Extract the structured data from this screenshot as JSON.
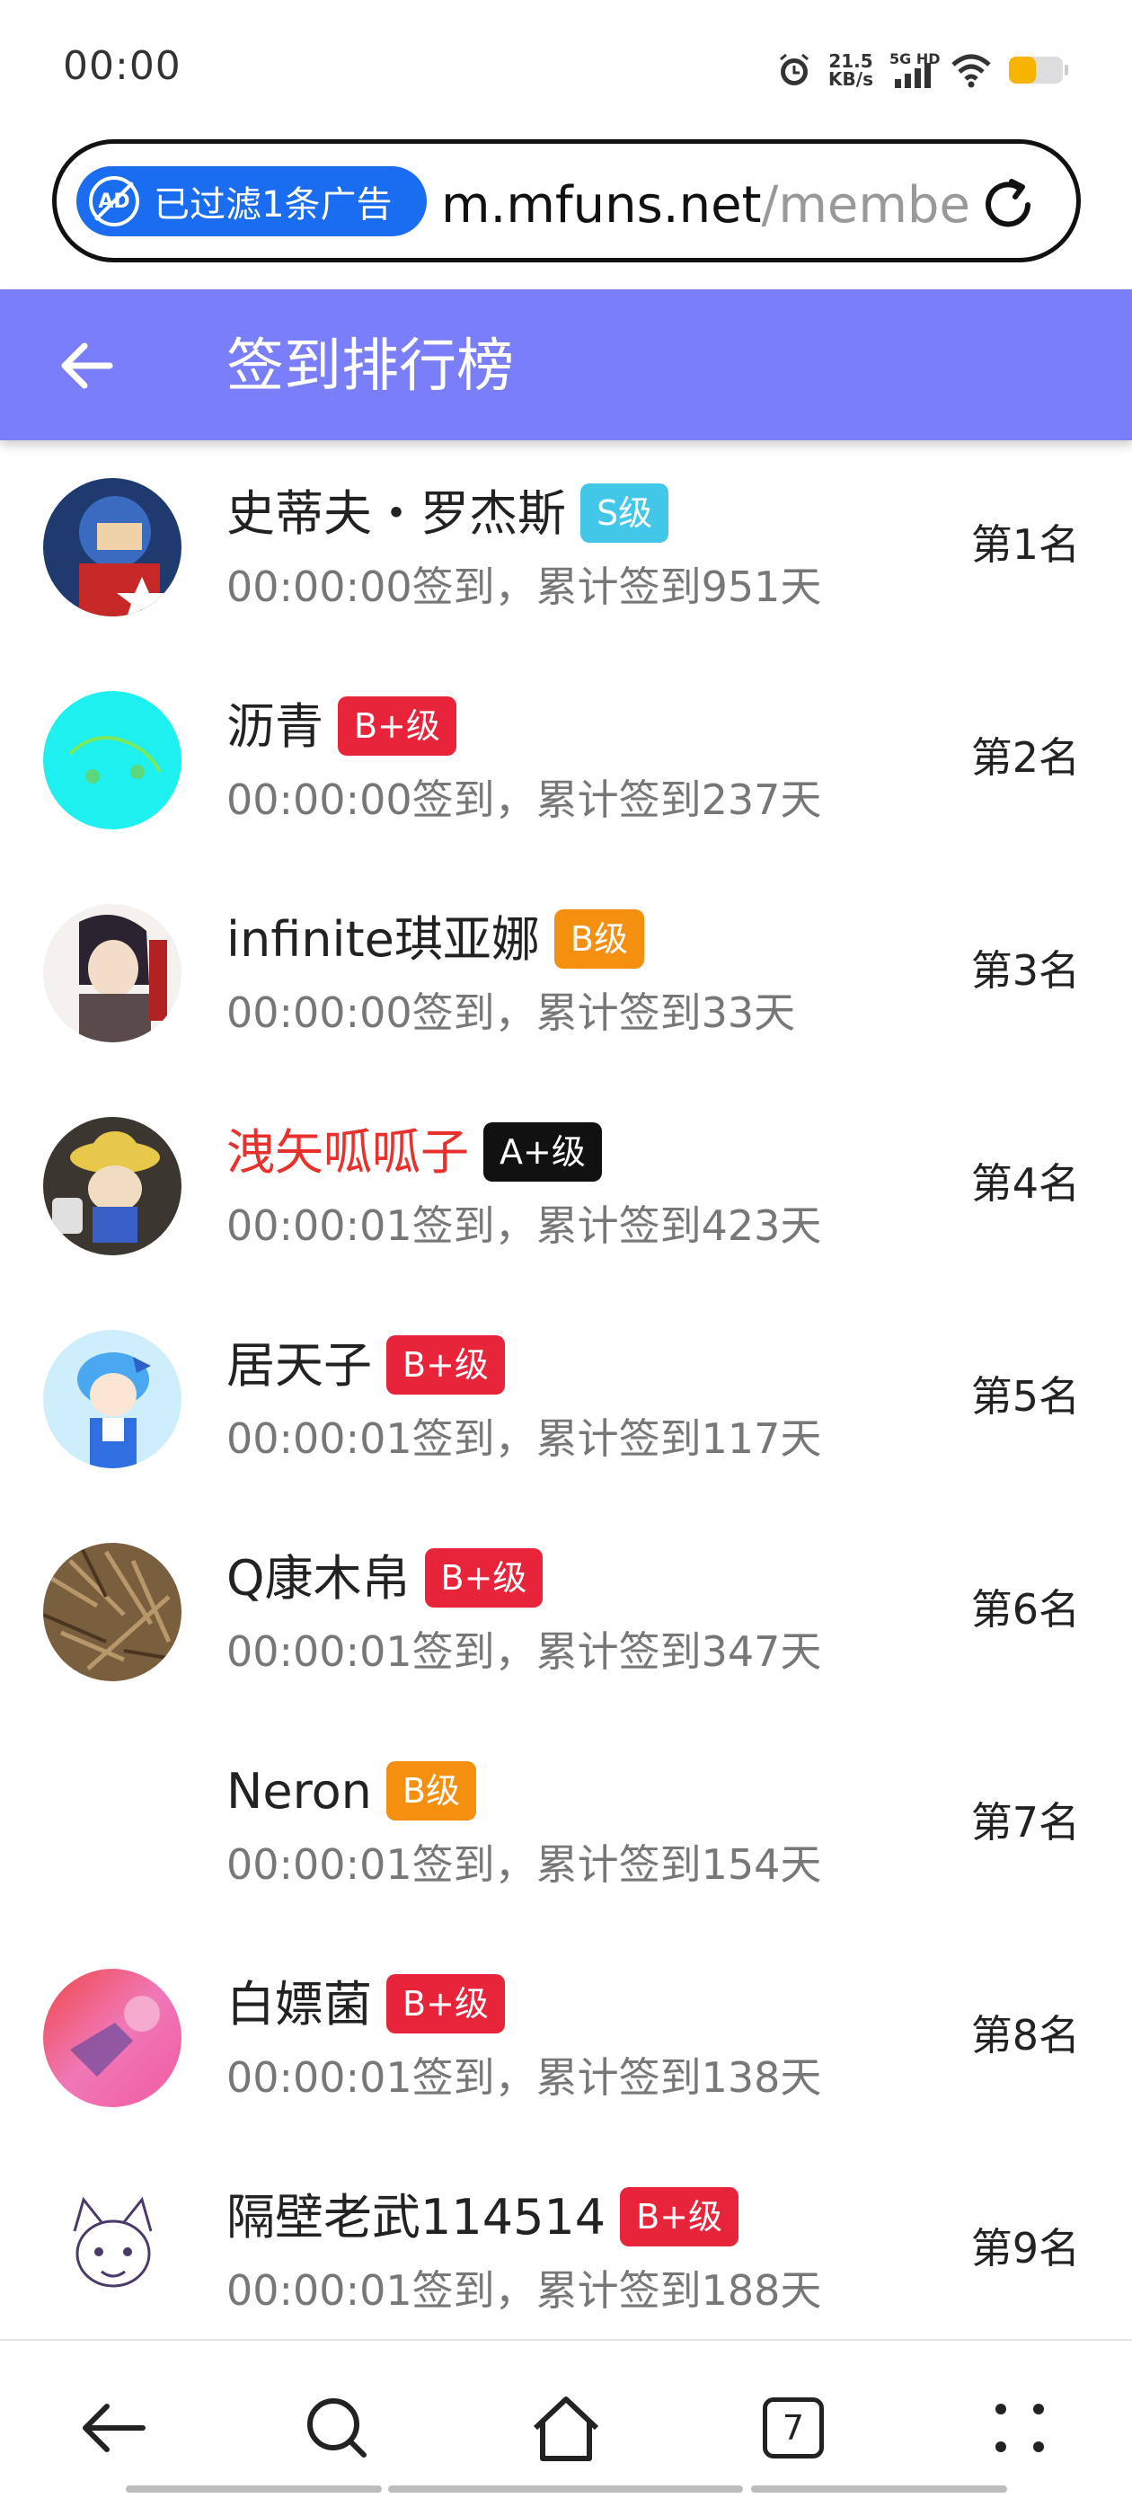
{
  "status_bar": {
    "time": "00:00",
    "net_speed_value": "21.5",
    "net_speed_unit": "KB/s",
    "network_label": "5G HD",
    "battery_color": "#f6b400"
  },
  "browser": {
    "ad_filter_text": "已过滤1条广告",
    "url_host": "m.mfuns.net",
    "url_path": "/membe",
    "ad_icon_text": "AD"
  },
  "header": {
    "title": "签到排行榜"
  },
  "ranking": [
    {
      "name": "史蒂夫・罗杰斯",
      "level": "S级",
      "level_type": "s",
      "info": "00:00:00签到，累计签到951天",
      "rank": "第1名",
      "avatar": "avatar-captain"
    },
    {
      "name": "沥青",
      "level": "B+级",
      "level_type": "bplus",
      "info": "00:00:00签到，累计签到237天",
      "rank": "第2名",
      "avatar": "avatar-cyan"
    },
    {
      "name": "infinite琪亚娜",
      "level": "B级",
      "level_type": "b",
      "info": "00:00:00签到，累计签到33天",
      "rank": "第3名",
      "avatar": "avatar-anime-dark"
    },
    {
      "name": "洩矢呱呱子",
      "level": "A+级",
      "level_type": "aplus",
      "info": "00:00:01签到，累计签到423天",
      "rank": "第4名",
      "avatar": "avatar-figure",
      "highlight": true
    },
    {
      "name": "居天子",
      "level": "B+级",
      "level_type": "bplus",
      "info": "00:00:01签到，累计签到117天",
      "rank": "第5名",
      "avatar": "avatar-cirno"
    },
    {
      "name": "Q康木帛",
      "level": "B+级",
      "level_type": "bplus",
      "info": "00:00:01签到，累计签到347天",
      "rank": "第6名",
      "avatar": "avatar-grass"
    },
    {
      "name": "Neron",
      "level": "B级",
      "level_type": "b",
      "info": "00:00:01签到，累计签到154天",
      "rank": "第7名",
      "avatar": "avatar-blank"
    },
    {
      "name": "白嫖菌",
      "level": "B+级",
      "level_type": "bplus",
      "info": "00:00:01签到，累计签到138天",
      "rank": "第8名",
      "avatar": "avatar-pink"
    },
    {
      "name": "隔壁老武114514",
      "level": "B+级",
      "level_type": "bplus",
      "info": "00:00:01签到，累计签到188天",
      "rank": "第9名",
      "avatar": "avatar-sketch"
    }
  ],
  "bottom_nav": {
    "tab_count": "7",
    "items": [
      "back-icon",
      "search-icon",
      "home-icon",
      "tabs-icon",
      "more-icon"
    ]
  },
  "colors": {
    "header_bg": "#7a7ef8",
    "badge_s": "#43c7e8",
    "badge_bplus": "#e8243a",
    "badge_b": "#f58f0f",
    "badge_aplus": "#111111",
    "highlight_name": "#e8302c",
    "ad_pill": "#1a6cf0"
  }
}
